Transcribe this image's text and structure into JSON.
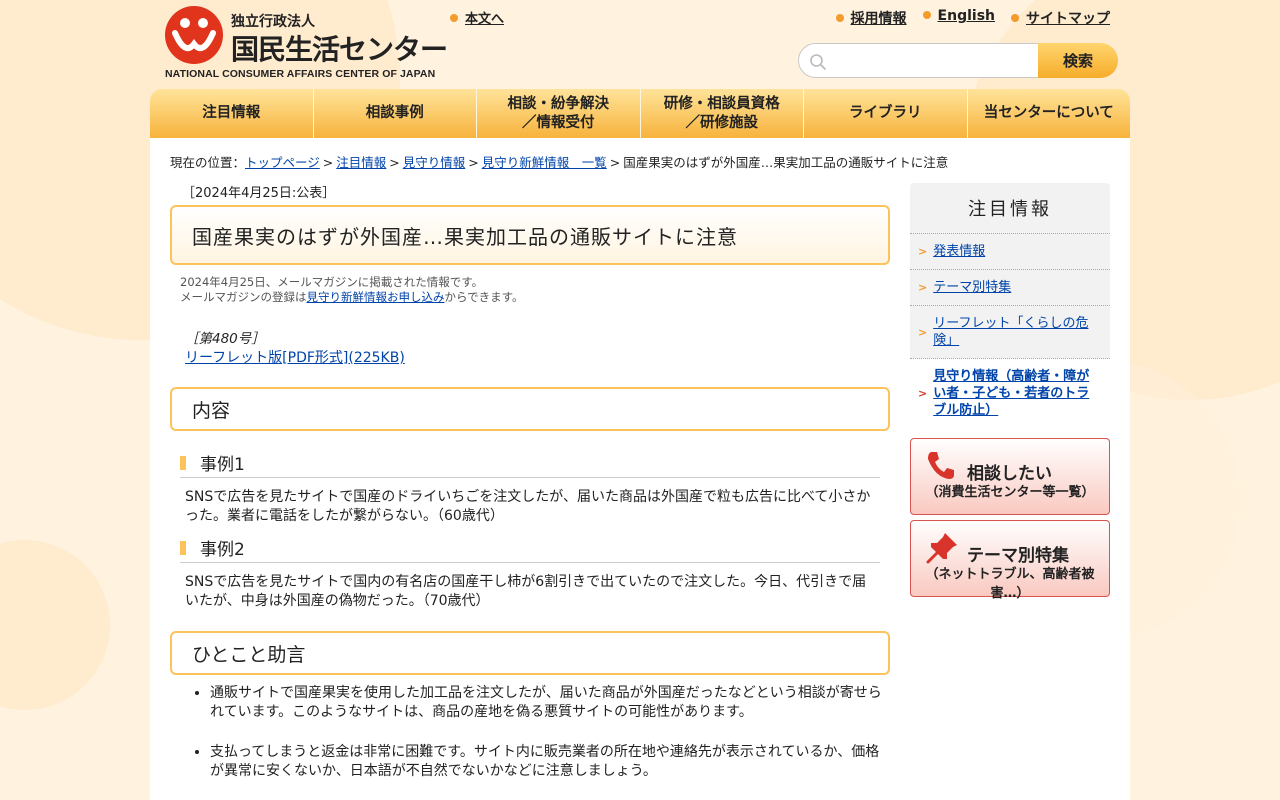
{
  "header": {
    "logo_small": "独立行政法人",
    "logo_big": "国民生活センター",
    "logo_en": "NATIONAL CONSUMER AFFAIRS CENTER OF JAPAN",
    "skip_link": "本文へ",
    "util_links": [
      "採用情報",
      "English",
      "サイトマップ"
    ],
    "search_button": "検索",
    "search_placeholder": ""
  },
  "gnav": [
    "注目情報",
    "相談事例",
    "相談・紛争解決\n／情報受付",
    "研修・相談員資格\n／研修施設",
    "ライブラリ",
    "当センターについて"
  ],
  "breadcrumb": {
    "prefix": "現在の位置：",
    "items": [
      "トップページ",
      "注目情報",
      "見守り情報",
      "見守り新鮮情報　一覧"
    ],
    "current": "国産果実のはずが外国産…果実加工品の通販サイトに注意"
  },
  "article": {
    "pubdate": "［2024年4月25日:公表］",
    "title": "国産果実のはずが外国産…果実加工品の通販サイトに注意",
    "meta_line1": "2024年4月25日、メールマガジンに掲載された情報です。",
    "meta_line2_pre": "メールマガジンの登録は",
    "meta_line2_link": "見守り新鮮情報お申し込み",
    "meta_line2_post": "からできます。",
    "issue": "［第480号］",
    "leaflet_link": "リーフレット版[PDF形式](225KB)",
    "section_content": "内容",
    "case1_title": "事例1",
    "case1_text": "SNSで広告を見たサイトで国産のドライいちごを注文したが、届いた商品は外国産で粒も広告に比べて小さかった。業者に電話をしたが繋がらない。（60歳代）",
    "case2_title": "事例2",
    "case2_text": "SNSで広告を見たサイトで国内の有名店の国産干し柿が6割引きで出ていたので注文した。今日、代引きで届いたが、中身は外国産の偽物だった。（70歳代）",
    "section_advice": "ひとこと助言",
    "advice": [
      "通販サイトで国産果実を使用した加工品を注文したが、届いた商品が外国産だったなどという相談が寄せられています。このようなサイトは、商品の産地を偽る悪質サイトの可能性があります。",
      "支払ってしまうと返金は非常に困難です。サイト内に販売業者の所在地や連絡先が表示されているか、価格が異常に安くないか、日本語が不自然でないかなどに注意しましょう。"
    ]
  },
  "side": {
    "title": "注目情報",
    "items": [
      "発表情報",
      "テーマ別特集",
      "リーフレット「くらしの危険」",
      "見守り情報（高齢者・障がい者・子ども・若者のトラブル防止）"
    ],
    "banner1_main": "相談したい",
    "banner1_sub": "（消費生活センター等一覧）",
    "banner2_main": "テーマ別特集",
    "banner2_sub": "（ネットトラブル、高齢者被害…）"
  },
  "colors": {
    "accent": "#fcc35b",
    "brand_red": "#e0341c",
    "link": "#0044aa"
  }
}
